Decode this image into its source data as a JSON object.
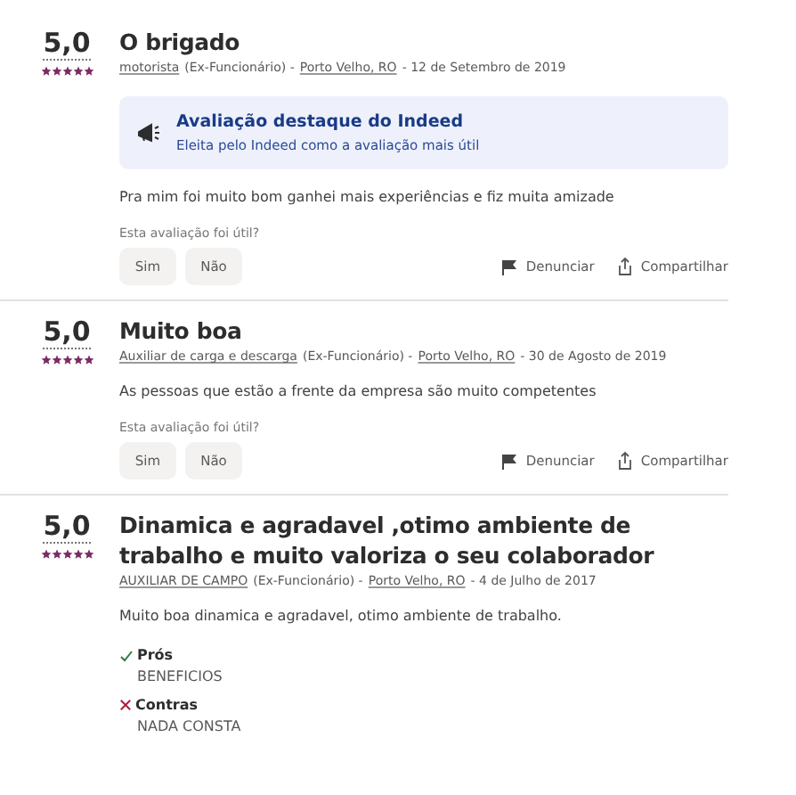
{
  "reviews": [
    {
      "rating": "5,0",
      "stars": 5,
      "title": "O brigado",
      "role": "motorista",
      "status": "(Ex-Funcionário) -",
      "location": "Porto Velho, RO",
      "date": "- 12 de Setembro de 2019",
      "highlight": {
        "title": "Avaliação destaque do Indeed",
        "subtitle": "Eleita pelo Indeed como a avaliação mais útil"
      },
      "text": "Pra mim foi muito bom ganhei mais experiências e fiz muita amizade",
      "question": "Esta avaliação foi útil?",
      "votes": [
        "Sim",
        "Não"
      ],
      "actions": [
        {
          "kind": "report",
          "label": "Denunciar"
        },
        {
          "kind": "share",
          "label": "Compartilhar"
        }
      ]
    },
    {
      "rating": "5,0",
      "stars": 5,
      "title": "Muito boa",
      "role": "Auxiliar de carga e descarga",
      "status": "(Ex-Funcionário) -",
      "location": "Porto Velho, RO",
      "date": "- 30 de Agosto de 2019",
      "text": "As pessoas que estão a frente da empresa são muito competentes",
      "question": "Esta avaliação foi útil?",
      "votes": [
        "Sim",
        "Não"
      ],
      "actions": [
        {
          "kind": "report",
          "label": "Denunciar"
        },
        {
          "kind": "share",
          "label": "Compartilhar"
        }
      ]
    },
    {
      "rating": "5,0",
      "stars": 5,
      "title": "Dinamica e agradavel ,otimo ambiente de trabalho e muito valoriza o seu colaborador",
      "role": "AUXILIAR DE CAMPO",
      "status": "(Ex-Funcionário) -",
      "location": "Porto Velho, RO",
      "date": "- 4 de Julho de 2017",
      "text": "Muito boa dinamica e agradavel, otimo ambiente de trabalho.",
      "points": [
        {
          "kind": "pro",
          "label": "Prós",
          "text": "BENEFICIOS"
        },
        {
          "kind": "con",
          "label": "Contras",
          "text": "NADA CONSTA"
        }
      ]
    }
  ]
}
